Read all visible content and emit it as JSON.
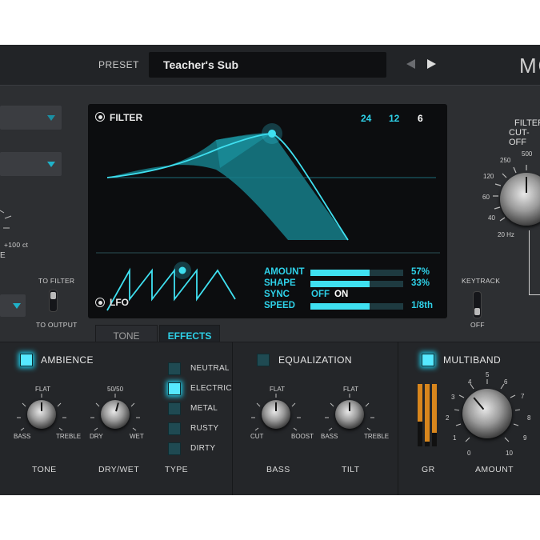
{
  "header": {
    "preset_label": "PRESET",
    "preset_name": "Teacher's Sub",
    "brand": "MO",
    "prev_icon": "triangle-left-icon",
    "next_icon": "triangle-right-icon"
  },
  "left": {
    "knob_value": "+100 ct",
    "knob_caption": "E",
    "switch_top": "TO FILTER",
    "switch_bottom": "TO OUTPUT"
  },
  "filter": {
    "title": "FILTER",
    "slopes": [
      "24",
      "12",
      "6"
    ],
    "selected_slope": "6"
  },
  "lfo": {
    "title": "LFO",
    "amount_label": "AMOUNT",
    "amount_value": "57%",
    "amount_fraction": 0.64,
    "shape_label": "SHAPE",
    "shape_value": "33%",
    "shape_fraction": 0.64,
    "sync_label": "SYNC",
    "sync_off": "OFF",
    "sync_on": "ON",
    "speed_label": "SPEED",
    "speed_value": "1/8th",
    "speed_fraction": 0.64
  },
  "cutoff": {
    "title_line1": "FILTER",
    "title_line2": "CUT-OFF",
    "scale": [
      "20 Hz",
      "40",
      "60",
      "120",
      "250",
      "500"
    ]
  },
  "keytrack": {
    "label": "KEYTRACK",
    "state": "OFF"
  },
  "tabs": {
    "tone": "TONE",
    "effects": "EFFECTS"
  },
  "ambience": {
    "title": "AMBIENCE",
    "tone_flat": "FLAT",
    "tone_bass": "BASS",
    "tone_treble": "TREBLE",
    "tone_caption": "TONE",
    "drywet_top": "50/50",
    "drywet_dry": "DRY",
    "drywet_wet": "WET",
    "drywet_caption": "DRY/WET",
    "type_caption": "TYPE",
    "types": [
      "NEUTRAL",
      "ELECTRIC",
      "METAL",
      "RUSTY",
      "DIRTY"
    ],
    "selected_type": "ELECTRIC"
  },
  "equalization": {
    "title": "EQUALIZATION",
    "bass_flat": "FLAT",
    "bass_cut": "CUT",
    "bass_boost": "BOOST",
    "bass_caption": "BASS",
    "tilt_flat": "FLAT",
    "tilt_bass": "BASS",
    "tilt_treble": "TREBLE",
    "tilt_caption": "TILT"
  },
  "multiband": {
    "title": "MULTIBAND",
    "gr_caption": "GR",
    "amount_caption": "AMOUNT",
    "scale": [
      "0",
      "1",
      "2",
      "3",
      "4",
      "5",
      "6",
      "7",
      "8",
      "9",
      "10"
    ],
    "gr_levels": [
      0.6,
      0.92,
      0.78
    ]
  },
  "colors": {
    "accent": "#2ed1e8",
    "meter": "#d8861d",
    "panel": "#2d2f32"
  }
}
